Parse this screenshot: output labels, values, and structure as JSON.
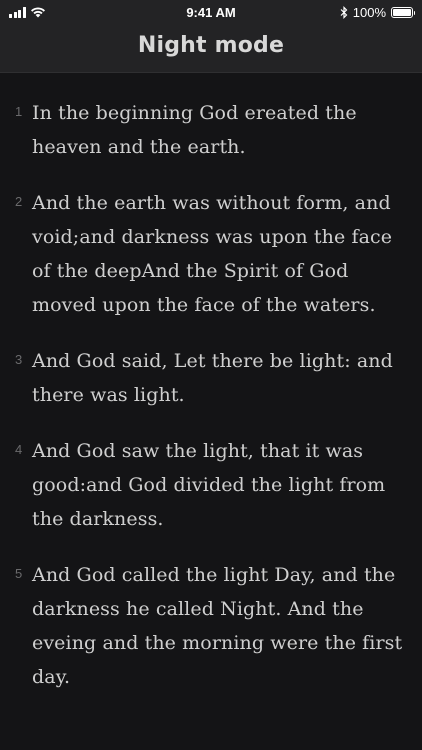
{
  "status_bar": {
    "time": "9:41 AM",
    "battery": "100%",
    "icons": [
      "signal-icon",
      "wifi-icon",
      "bluetooth-icon",
      "battery-icon"
    ]
  },
  "nav": {
    "title": "Night mode"
  },
  "verses": [
    {
      "number": "1",
      "text": "In the beginning God ereated the heaven and the earth."
    },
    {
      "number": "2",
      "text": "And the earth was without form, and void;and darkness was upon the face of the deepAnd the Spirit of God moved upon the face of the waters."
    },
    {
      "number": "3",
      "text": "And God said, Let there be light: and there was light."
    },
    {
      "number": "4",
      "text": "And God saw the light, that it was good:and God divided the light from the darkness."
    },
    {
      "number": "5",
      "text": "And God called the light Day, and the darkness he called Night. And the eveing and the morning were the first day."
    }
  ],
  "colors": {
    "background": "#141416",
    "header": "#232325",
    "verse_text": "#cfcfcf",
    "verse_number": "#6a6a6c"
  }
}
